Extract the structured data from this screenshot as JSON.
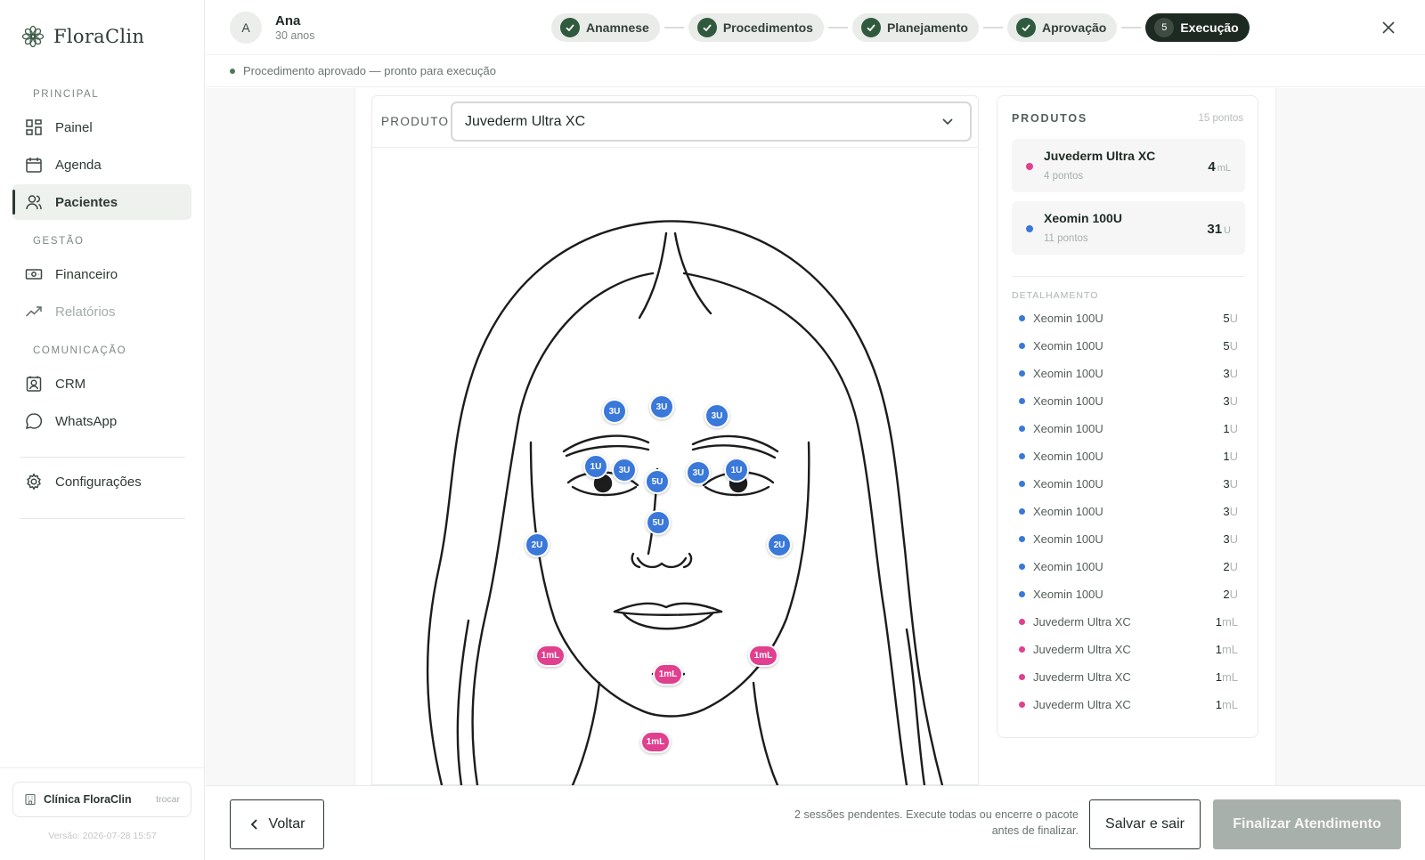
{
  "brand": {
    "name": "FloraClin"
  },
  "sidebar": {
    "sections": [
      {
        "label": "PRINCIPAL",
        "items": [
          {
            "label": "Painel",
            "icon": "grid-icon"
          },
          {
            "label": "Agenda",
            "icon": "calendar-icon"
          },
          {
            "label": "Pacientes",
            "icon": "users-icon",
            "active": true
          }
        ]
      },
      {
        "label": "GESTÃO",
        "items": [
          {
            "label": "Financeiro",
            "icon": "banknote-icon"
          },
          {
            "label": "Relatórios",
            "icon": "trend-icon",
            "muted": true
          }
        ]
      },
      {
        "label": "COMUNICAÇÃO",
        "items": [
          {
            "label": "CRM",
            "icon": "contact-icon"
          },
          {
            "label": "WhatsApp",
            "icon": "chat-icon"
          }
        ]
      }
    ],
    "settings_label": "Configurações",
    "clinic": {
      "name": "Clínica FloraClin",
      "change_label": "trocar"
    },
    "version": "Versão: 2026-07-28 15:57"
  },
  "patient": {
    "initial": "A",
    "name": "Ana",
    "age": "30 anos"
  },
  "stepper": [
    {
      "label": "Anamnese",
      "done": true
    },
    {
      "label": "Procedimentos",
      "done": true
    },
    {
      "label": "Planejamento",
      "done": true
    },
    {
      "label": "Aprovação",
      "done": true
    },
    {
      "label": "Execução",
      "number": "5",
      "active": true
    }
  ],
  "status": {
    "text": "Procedimento aprovado — pronto para execução"
  },
  "product_selector": {
    "label": "PRODUTO",
    "value": "Juvederm Ultra XC"
  },
  "markers": [
    {
      "label": "3U",
      "type": "u"
    },
    {
      "label": "3U",
      "type": "u"
    },
    {
      "label": "3U",
      "type": "u"
    },
    {
      "label": "1U",
      "type": "u"
    },
    {
      "label": "3U",
      "type": "u"
    },
    {
      "label": "5U",
      "type": "u"
    },
    {
      "label": "3U",
      "type": "u"
    },
    {
      "label": "1U",
      "type": "u"
    },
    {
      "label": "5U",
      "type": "u"
    },
    {
      "label": "2U",
      "type": "u"
    },
    {
      "label": "2U",
      "type": "u"
    },
    {
      "label": "1mL",
      "type": "ml"
    },
    {
      "label": "1mL",
      "type": "ml"
    },
    {
      "label": "1mL",
      "type": "ml"
    },
    {
      "label": "1mL",
      "type": "ml"
    }
  ],
  "products_panel": {
    "title": "PRODUTOS",
    "count": "15 pontos",
    "summary": [
      {
        "name": "Juvederm Ultra XC",
        "points": "4 pontos",
        "value": "4",
        "unit": "mL",
        "color": "#e0408e"
      },
      {
        "name": "Xeomin 100U",
        "points": "11 pontos",
        "value": "31",
        "unit": "U",
        "color": "#3a78d9"
      }
    ],
    "detail_title": "DETALHAMENTO",
    "details": [
      {
        "name": "Xeomin 100U",
        "value": "5",
        "unit": "U",
        "color": "#3a78d9"
      },
      {
        "name": "Xeomin 100U",
        "value": "5",
        "unit": "U",
        "color": "#3a78d9"
      },
      {
        "name": "Xeomin 100U",
        "value": "3",
        "unit": "U",
        "color": "#3a78d9"
      },
      {
        "name": "Xeomin 100U",
        "value": "3",
        "unit": "U",
        "color": "#3a78d9"
      },
      {
        "name": "Xeomin 100U",
        "value": "1",
        "unit": "U",
        "color": "#3a78d9"
      },
      {
        "name": "Xeomin 100U",
        "value": "1",
        "unit": "U",
        "color": "#3a78d9"
      },
      {
        "name": "Xeomin 100U",
        "value": "3",
        "unit": "U",
        "color": "#3a78d9"
      },
      {
        "name": "Xeomin 100U",
        "value": "3",
        "unit": "U",
        "color": "#3a78d9"
      },
      {
        "name": "Xeomin 100U",
        "value": "3",
        "unit": "U",
        "color": "#3a78d9"
      },
      {
        "name": "Xeomin 100U",
        "value": "2",
        "unit": "U",
        "color": "#3a78d9"
      },
      {
        "name": "Xeomin 100U",
        "value": "2",
        "unit": "U",
        "color": "#3a78d9"
      },
      {
        "name": "Juvederm Ultra XC",
        "value": "1",
        "unit": "mL",
        "color": "#e0408e"
      },
      {
        "name": "Juvederm Ultra XC",
        "value": "1",
        "unit": "mL",
        "color": "#e0408e"
      },
      {
        "name": "Juvederm Ultra XC",
        "value": "1",
        "unit": "mL",
        "color": "#e0408e"
      },
      {
        "name": "Juvederm Ultra XC",
        "value": "1",
        "unit": "mL",
        "color": "#e0408e"
      }
    ]
  },
  "footer": {
    "back_label": "Voltar",
    "pending_text": "2 sessões pendentes. Execute todas ou encerre o pacote antes de finalizar.",
    "save_label": "Salvar e sair",
    "finish_label": "Finalizar Atendimento"
  }
}
